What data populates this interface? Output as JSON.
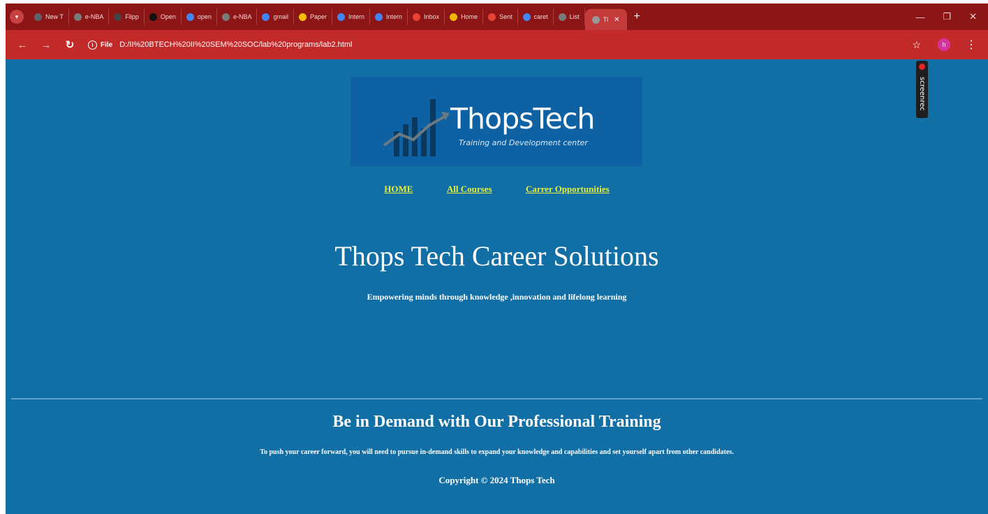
{
  "browser": {
    "tabs": [
      {
        "title": "New T",
        "icon": "chrome-icon",
        "color": "#5f6368"
      },
      {
        "title": "e-NBA",
        "icon": "globe-icon",
        "color": "#7a7a7a"
      },
      {
        "title": "Flipp",
        "icon": "chatgpt-icon",
        "color": "#444444"
      },
      {
        "title": "Open",
        "icon": "openai-icon",
        "color": "#111111"
      },
      {
        "title": "open",
        "icon": "google-icon",
        "color": "#4285f4"
      },
      {
        "title": "e-NBA",
        "icon": "globe-icon",
        "color": "#7a7a7a"
      },
      {
        "title": "gmail",
        "icon": "google-icon",
        "color": "#4285f4"
      },
      {
        "title": "Paper",
        "icon": "drive-icon",
        "color": "#fbbc04"
      },
      {
        "title": "Intern",
        "icon": "docs-icon",
        "color": "#4285f4"
      },
      {
        "title": "Intern",
        "icon": "docs-icon",
        "color": "#4285f4"
      },
      {
        "title": "Inbox",
        "icon": "gmail-icon",
        "color": "#ea4335"
      },
      {
        "title": "Home",
        "icon": "classroom-icon",
        "color": "#f4b400"
      },
      {
        "title": "Sent",
        "icon": "gmail-icon",
        "color": "#ea4335"
      },
      {
        "title": "caret",
        "icon": "bookmark-icon",
        "color": "#4285f4"
      },
      {
        "title": "List",
        "icon": "globe-icon",
        "color": "#7a7a7a"
      },
      {
        "title": "Tl",
        "icon": "globe-icon",
        "color": "#999999",
        "active": true
      }
    ],
    "address": {
      "scheme_label": "File",
      "url": "D:/II%20BTECH%20II%20SEM%20SOC/lab%20programs/lab2.html"
    },
    "profile_initial": "h",
    "colors": {
      "tabstrip": "#8c1515",
      "toolbar": "#c22a2a"
    }
  },
  "page": {
    "logo": {
      "title": "ThopsTech",
      "subtitle": "Training and Development center"
    },
    "nav": {
      "home": "HOME",
      "courses": "All Courses",
      "careers": "Carrer Opportunities"
    },
    "hero": {
      "title": "Thops Tech Career Solutions",
      "subtitle": "Empowering minds through knowledge ,innovation and lifelong learning"
    },
    "section": {
      "title": "Be in Demand with Our Professional Training",
      "text": "To push your career forward, you will need to pursue in-demand skills to expand your knowledge and capabilities and set yourself apart from other candidates.",
      "copyright": "Copyright © 2024 Thops Tech"
    },
    "overlay": {
      "label": "screenrec"
    },
    "colors": {
      "background": "#116fa6",
      "link": "#e6f03a"
    }
  }
}
